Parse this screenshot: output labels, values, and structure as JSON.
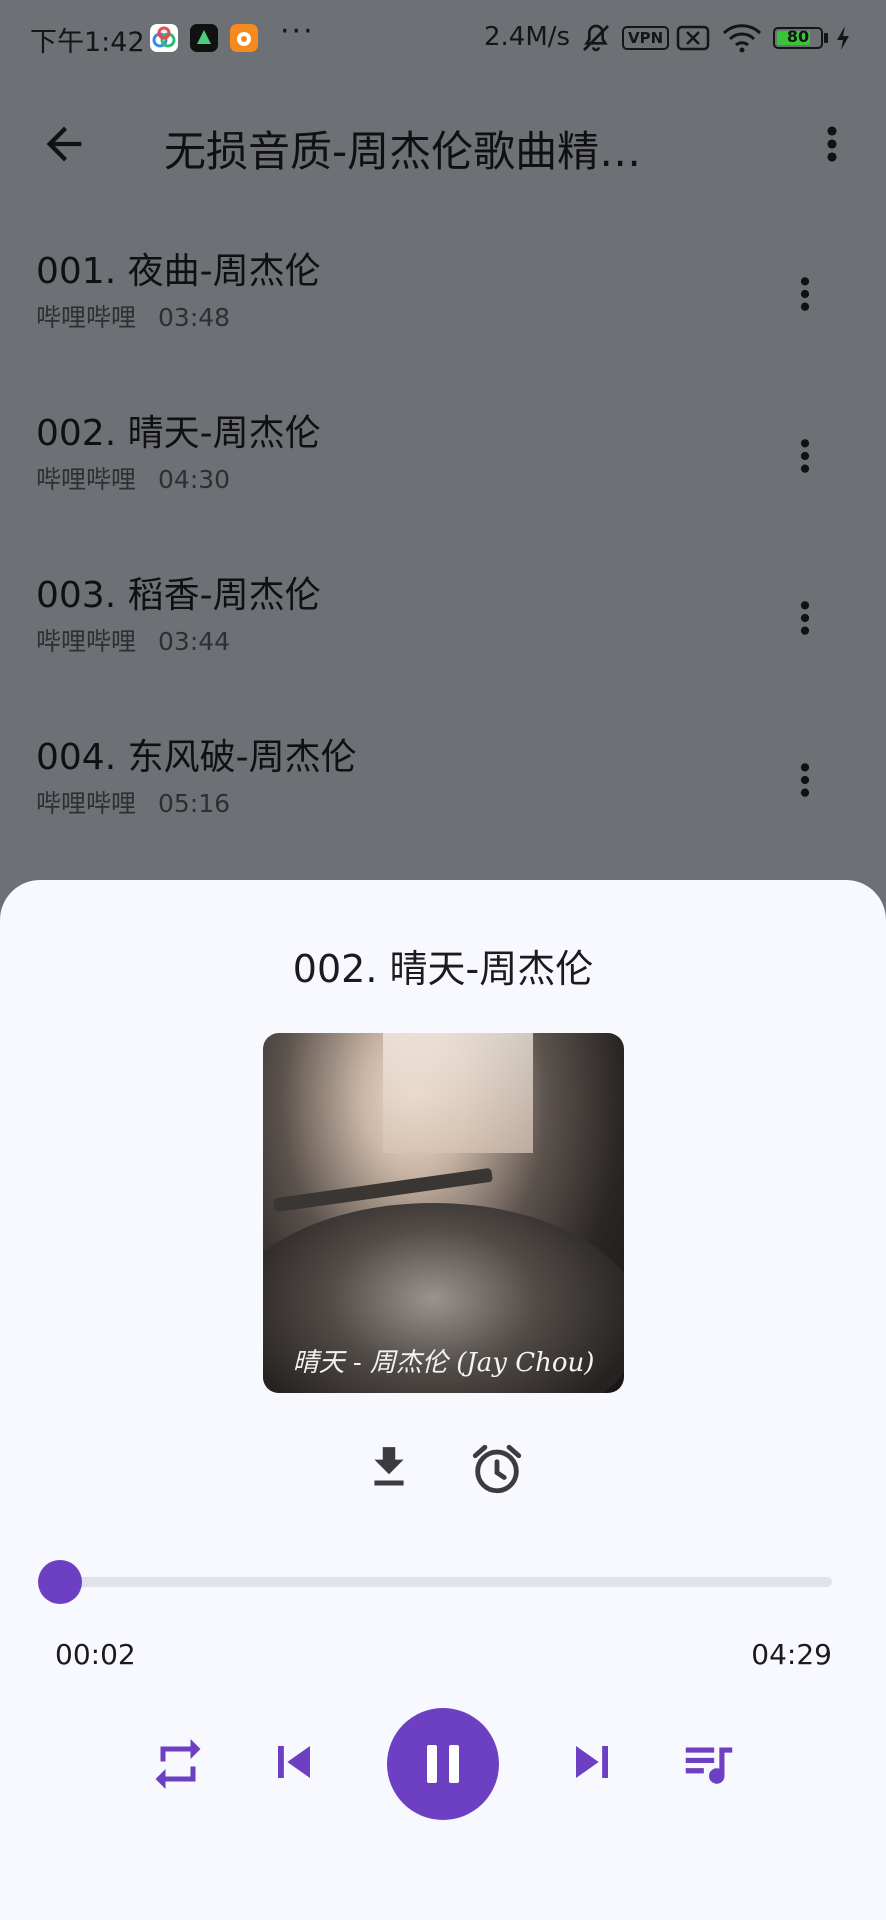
{
  "status_bar": {
    "time": "下午1:42",
    "overflow": "···",
    "net_speed": "2.4M/s",
    "vpn": "VPN",
    "battery": "80",
    "battery_level": 0.8,
    "icons": [
      "app-icon-1",
      "app-icon-2",
      "app-icon-3",
      "mute-bell-icon",
      "vpn-icon",
      "no-sim-icon",
      "wifi-icon",
      "battery-icon",
      "charging-icon"
    ]
  },
  "appbar": {
    "title": "无损音质-周杰伦歌曲精…",
    "icons": [
      "back-arrow-icon",
      "more-vert-icon"
    ]
  },
  "songs": [
    {
      "title": "001. 夜曲-周杰伦",
      "source": "哔哩哔哩",
      "duration": "03:48"
    },
    {
      "title": "002. 晴天-周杰伦",
      "source": "哔哩哔哩",
      "duration": "04:30"
    },
    {
      "title": "003. 稻香-周杰伦",
      "source": "哔哩哔哩",
      "duration": "03:44"
    },
    {
      "title": "004. 东风破-周杰伦",
      "source": "哔哩哔哩",
      "duration": "05:16"
    }
  ],
  "player": {
    "title": "002. 晴天-周杰伦",
    "cover_caption": "晴天 - 周杰伦 (Jay Chou)",
    "current_time": "00:02",
    "total_time": "04:29",
    "progress": 0.0074,
    "accent_color": "#6d3fc2",
    "icons": [
      "download-icon",
      "alarm-clock-icon",
      "repeat-icon",
      "skip-previous-icon",
      "pause-icon",
      "skip-next-icon",
      "playlist-icon"
    ]
  }
}
